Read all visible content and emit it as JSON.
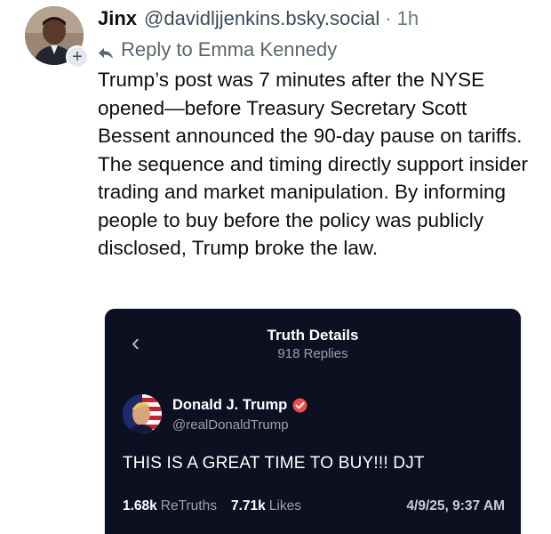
{
  "post": {
    "author_name": "Jinx",
    "author_handle": "@davidljjenkins.bsky.social",
    "separator": "·",
    "time": "1h",
    "reply_prefix": "Reply to",
    "reply_to": "Emma Kennedy",
    "follow_symbol": "+",
    "text": "Trump’s post was 7 minutes after the NYSE opened—before Treasury Secretary Scott Bessent announced the 90-day pause on tariffs. The sequence and timing directly support insider trading and market manipulation. By informing people to buy before the policy was publicly disclosed, Trump broke the law."
  },
  "embed": {
    "back_glyph": "‹",
    "title": "Truth Details",
    "subtitle": "918 Replies",
    "author_name": "Donald J. Trump",
    "author_handle": "@realDonaldTrump",
    "text": "THIS IS A GREAT TIME TO BUY!!! DJT",
    "retruths_count": "1.68k",
    "retruths_label": "ReTruths",
    "likes_count": "7.71k",
    "likes_label": "Likes",
    "date": "4/9/25, 9:37 AM"
  },
  "colors": {
    "embed_bg": "#0d1021",
    "verified": "#f04a4a",
    "muted_text": "#6b7785"
  },
  "icons": {
    "reply": "reply-arrow-icon",
    "back": "chevron-left-icon",
    "verified": "verified-badge-icon",
    "follow": "plus-icon"
  }
}
